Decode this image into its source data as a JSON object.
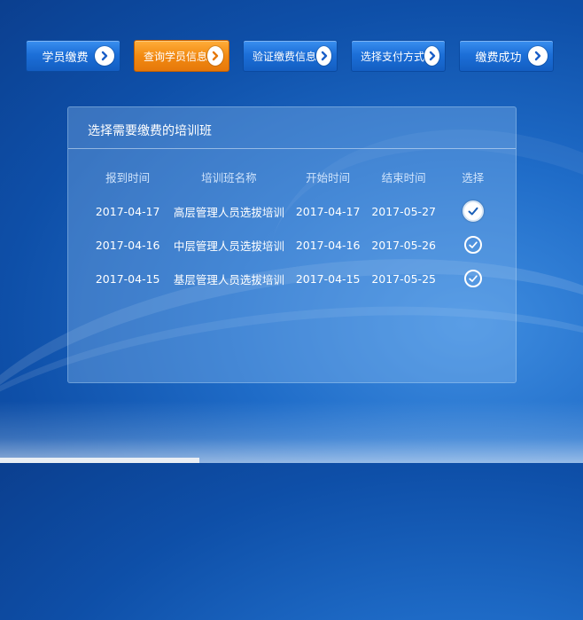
{
  "steps": [
    {
      "label": "学员缴费",
      "active": false
    },
    {
      "label": "查询学员信息",
      "active": true
    },
    {
      "label": "验证缴费信息",
      "active": false
    },
    {
      "label": "选择支付方式",
      "active": false
    },
    {
      "label": "缴费成功",
      "active": false
    }
  ],
  "panel": {
    "title": "选择需要缴费的培训班",
    "columns": [
      "报到时间",
      "培训班名称",
      "开始时间",
      "结束时间",
      "选择"
    ],
    "rows": [
      {
        "report_date": "2017-04-17",
        "course": "高层管理人员选拔培训",
        "start": "2017-04-17",
        "end": "2017-05-27",
        "selected": true
      },
      {
        "report_date": "2017-04-16",
        "course": "中层管理人员选拔培训",
        "start": "2017-04-16",
        "end": "2017-05-26",
        "selected": false
      },
      {
        "report_date": "2017-04-15",
        "course": "基层管理人员选拔培训",
        "start": "2017-04-15",
        "end": "2017-05-25",
        "selected": false
      }
    ]
  },
  "colors": {
    "accent_active": "#f28a12",
    "step_blue": "#1c6fd8",
    "arrow_blue": "#1a5fc8"
  },
  "icons": {
    "step_arrow": "chevron-right-icon",
    "select": "check-circle-icon"
  }
}
